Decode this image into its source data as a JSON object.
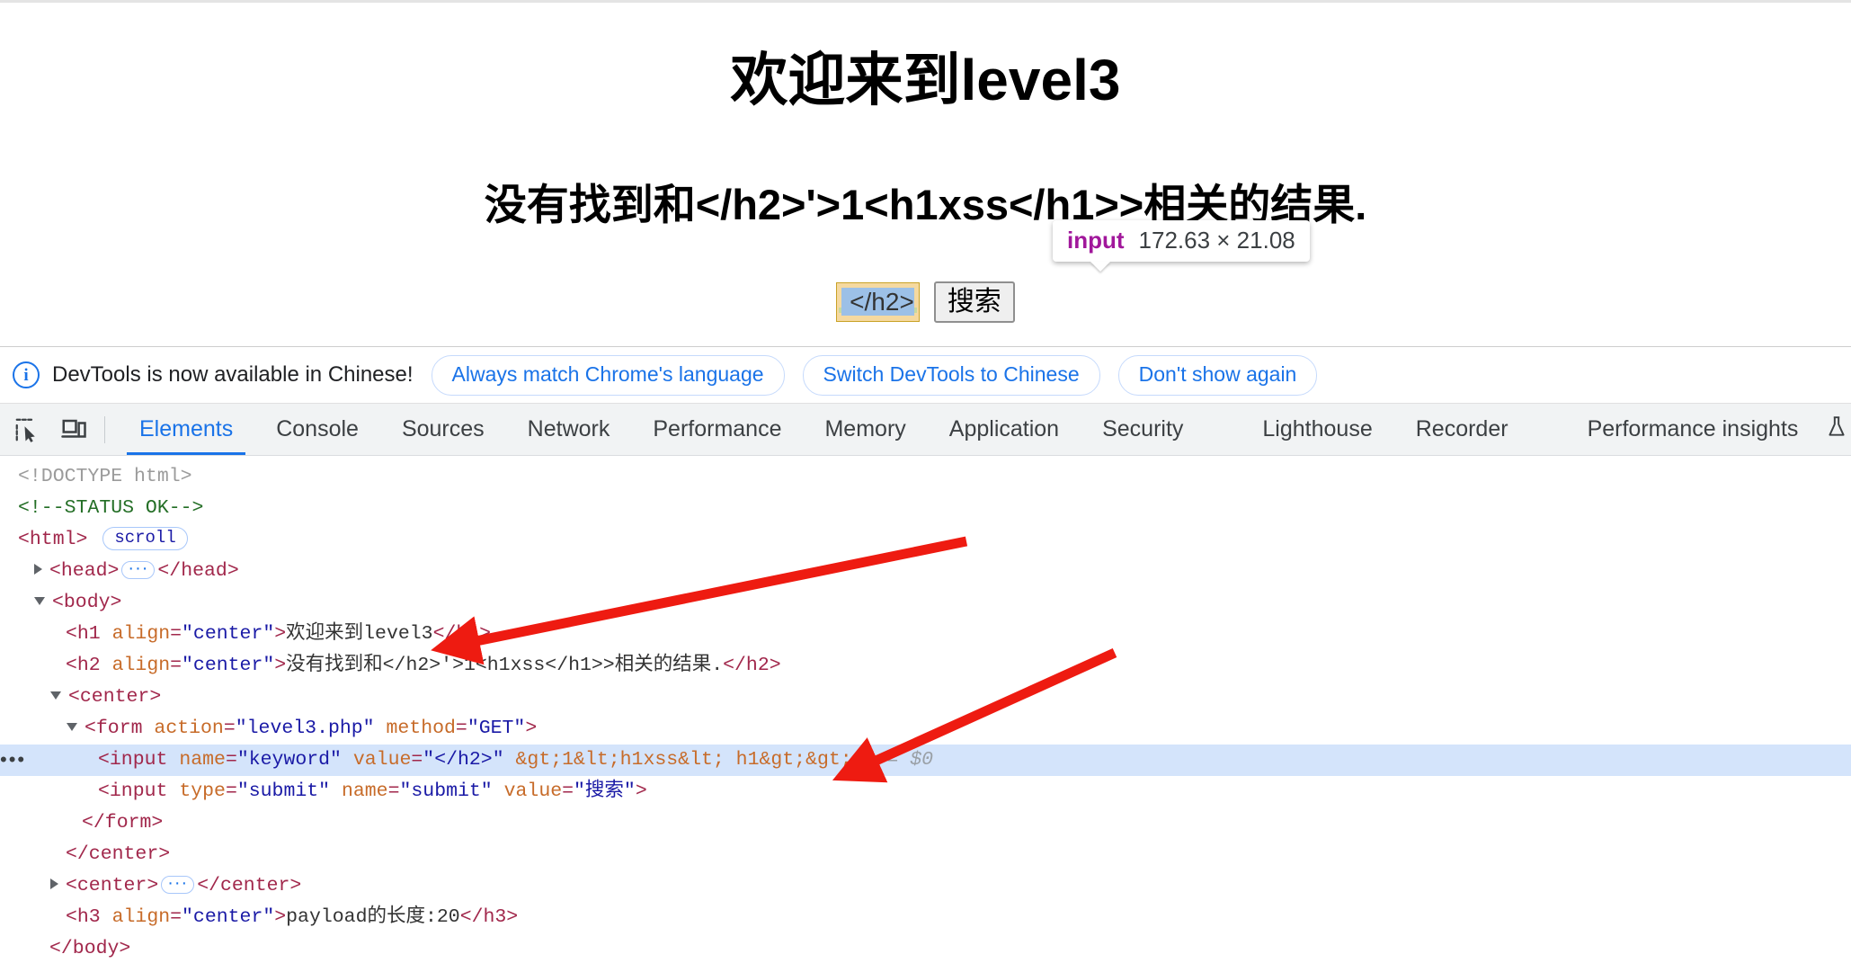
{
  "page": {
    "h1": "欢迎来到level3",
    "h2": "没有找到和</h2>'>1<h1xss</h1>>相关的结果.",
    "input_value": "</h2>",
    "search_button": "搜索"
  },
  "inspect_tooltip": {
    "tag": "input",
    "dimensions": "172.63 × 21.08"
  },
  "notice": {
    "icon": "info-icon",
    "message": "DevTools is now available in Chinese!",
    "buttons": [
      "Always match Chrome's language",
      "Switch DevTools to Chinese",
      "Don't show again"
    ]
  },
  "tabbar": {
    "inspect_icon": "inspect-element-icon",
    "device_icon": "device-toolbar-icon",
    "tabs": [
      "Elements",
      "Console",
      "Sources",
      "Network",
      "Performance",
      "Memory",
      "Application",
      "Security",
      "Lighthouse",
      "Recorder",
      "Performance insights"
    ],
    "active_tab": "Elements",
    "experiment_icon": "flask-icon",
    "accent_color": "#1a73e8"
  },
  "dom": {
    "doctype": "<!DOCTYPE html>",
    "comment": "<!--STATUS OK-->",
    "html_tag_open": "<html>",
    "scroll_badge": "scroll",
    "head_open": "<head>",
    "head_close": "</head>",
    "body_open": "<body>",
    "h1_line": {
      "open": "<h1 ",
      "attr": "align",
      "eq": "=",
      "value": "\"center\"",
      "gt": ">",
      "text": "欢迎来到level3",
      "close": "</h1>"
    },
    "h2_line": {
      "open": "<h2 ",
      "attr": "align",
      "eq": "=",
      "value": "\"center\"",
      "gt": ">",
      "text": "没有找到和</h2>'>1<h1xss</h1>>相关的结果.",
      "close": "</h2>"
    },
    "center_open": "<center>",
    "form_open": "<form ",
    "form_attr1": "action",
    "form_val1": "\"level3.php\"",
    "form_attr2": "method",
    "form_val2": "\"GET\"",
    "form_gt": ">",
    "input_keyword": {
      "open": "<input ",
      "attr1": "name",
      "val1": "\"keyword\"",
      "attr2": "value",
      "val2": "\"</h2>\"",
      "entities": "&gt;1&lt;h1xss&lt; h1&gt;&gt;'",
      "gt": ">",
      "selected_marker": "== $0"
    },
    "input_submit": {
      "open": "<input ",
      "attr1": "type",
      "val1": "\"submit\"",
      "attr2": "name",
      "val2": "\"submit\"",
      "attr3": "value",
      "val3": "\"搜索\"",
      "gt": ">"
    },
    "form_close": "</form>",
    "center_close": "</center>",
    "center2_open": "<center>",
    "center2_close": "</center>",
    "h3_line": {
      "open": "<h3 ",
      "attr": "align",
      "eq": "=",
      "value": "\"center\"",
      "gt": ">",
      "text": "payload的长度:20",
      "close": "</h3>"
    },
    "body_close": "</body>",
    "ellipsis": "···",
    "row_dots": "•••",
    "selected_row_color": "#d4e4fb"
  },
  "annotations": {
    "arrow_color": "#ee1b11",
    "arrow_count": 2
  }
}
